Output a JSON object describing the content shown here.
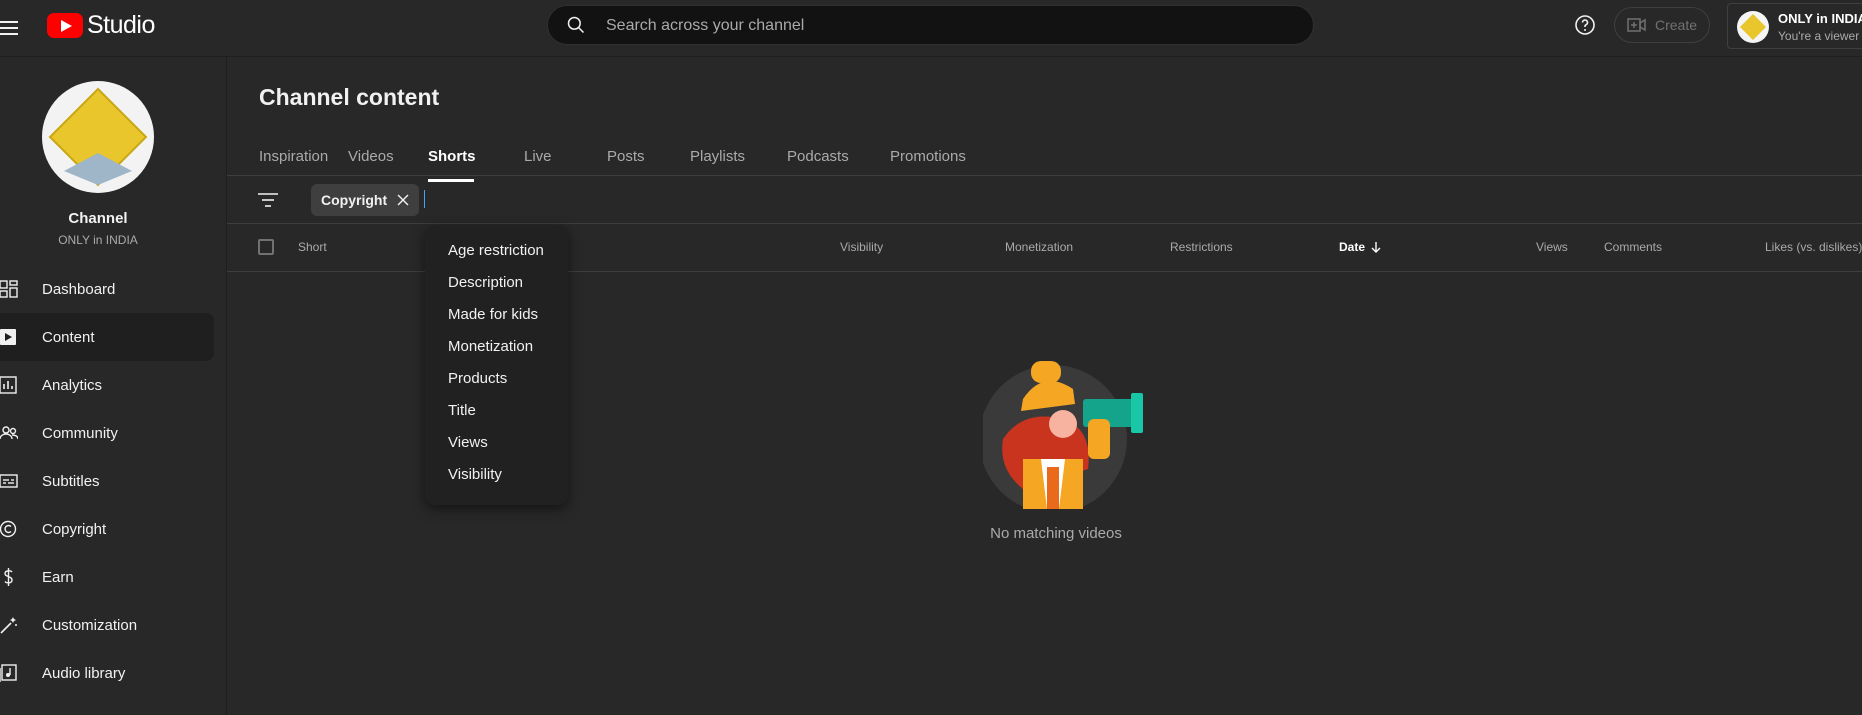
{
  "header": {
    "logo_text": "Studio",
    "search_placeholder": "Search across your channel",
    "create_label": "Create",
    "account": {
      "name": "ONLY in INDIA",
      "role": "You're a viewer"
    }
  },
  "sidebar": {
    "channel_title": "Channel",
    "channel_name": "ONLY in INDIA",
    "items": [
      {
        "label": "Dashboard",
        "icon": "dashboard-icon",
        "active": false
      },
      {
        "label": "Content",
        "icon": "content-icon",
        "active": true
      },
      {
        "label": "Analytics",
        "icon": "analytics-icon",
        "active": false
      },
      {
        "label": "Community",
        "icon": "community-icon",
        "active": false
      },
      {
        "label": "Subtitles",
        "icon": "subtitles-icon",
        "active": false
      },
      {
        "label": "Copyright",
        "icon": "copyright-icon",
        "active": false
      },
      {
        "label": "Earn",
        "icon": "earn-icon",
        "active": false
      },
      {
        "label": "Customization",
        "icon": "customization-icon",
        "active": false
      },
      {
        "label": "Audio library",
        "icon": "audio-library-icon",
        "active": false
      }
    ]
  },
  "main": {
    "title": "Channel content",
    "tabs": [
      {
        "label": "Inspiration",
        "active": false
      },
      {
        "label": "Videos",
        "active": false
      },
      {
        "label": "Shorts",
        "active": true
      },
      {
        "label": "Live",
        "active": false
      },
      {
        "label": "Posts",
        "active": false
      },
      {
        "label": "Playlists",
        "active": false
      },
      {
        "label": "Podcasts",
        "active": false
      },
      {
        "label": "Promotions",
        "active": false
      }
    ],
    "filter_chip": "Copyright",
    "columns": {
      "short": "Short",
      "visibility": "Visibility",
      "monetization": "Monetization",
      "restrictions": "Restrictions",
      "date": "Date",
      "views": "Views",
      "comments": "Comments",
      "likes": "Likes (vs. dislikes)"
    },
    "filter_menu": [
      "Age restriction",
      "Description",
      "Made for kids",
      "Monetization",
      "Products",
      "Title",
      "Views",
      "Visibility"
    ],
    "empty_text": "No matching videos"
  },
  "colors": {
    "background": "#282828",
    "brand_red": "#ff0000",
    "accent_blue": "#3ea6ff"
  }
}
